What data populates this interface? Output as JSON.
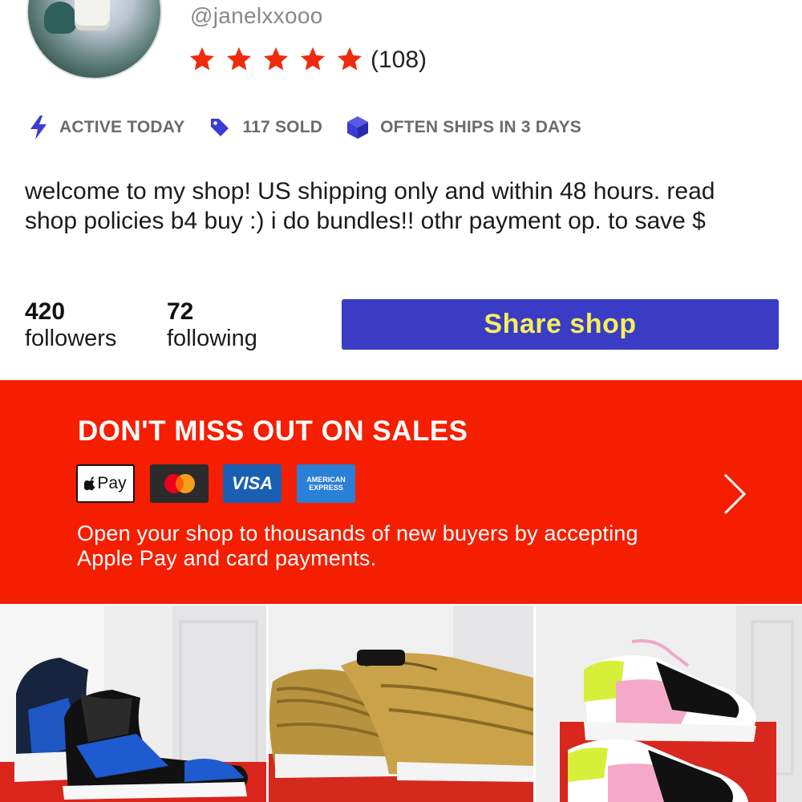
{
  "profile": {
    "handle": "@janelxxooo",
    "rating_stars": 5,
    "rating_count": "(108)",
    "avatar_icon": "user-avatar"
  },
  "badges": [
    {
      "icon": "lightning-icon",
      "label": "ACTIVE TODAY"
    },
    {
      "icon": "tag-icon",
      "label": "117 SOLD"
    },
    {
      "icon": "box-icon",
      "label": "OFTEN SHIPS IN 3 DAYS"
    }
  ],
  "bio": "welcome to my shop! US shipping only and within 48 hours. read shop policies b4 buy :) i do bundles!! othr payment op. to save $",
  "stats": {
    "followers_count": "420",
    "followers_label": "followers",
    "following_count": "72",
    "following_label": "following"
  },
  "share_button": "Share shop",
  "promo": {
    "title": "DON'T MISS OUT ON SALES",
    "applepay_label": "Pay",
    "visa_label": "VISA",
    "amex_label_1": "AMERICAN",
    "amex_label_2": "EXPRESS",
    "body": "Open your shop to thousands of new buyers by accepting Apple Pay and card payments."
  },
  "colors": {
    "accent_red": "#f51e00",
    "button_blue": "#3a3cc5",
    "button_text_yellow": "#f5f05a",
    "star_red": "#f02a0c",
    "badge_purple": "#3b3bd6"
  },
  "listings": [
    {
      "icon": "sneaker-photo",
      "subject": "blue-black-high-top-sneakers"
    },
    {
      "icon": "sneaker-photo",
      "subject": "gold-sneakers"
    },
    {
      "icon": "sneaker-photo",
      "subject": "pink-white-chunky-sneakers"
    }
  ]
}
